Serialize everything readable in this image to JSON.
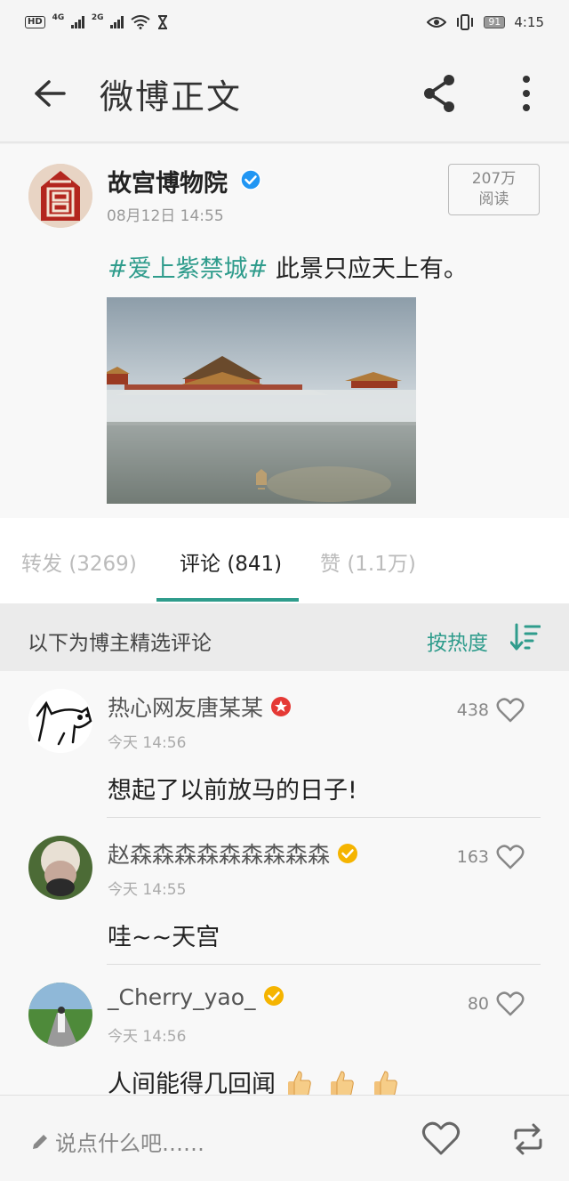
{
  "status_bar": {
    "hd": "HD",
    "net1": "4G",
    "net2": "2G",
    "battery": "91",
    "time": "4:15"
  },
  "header": {
    "title": "微博正文"
  },
  "post": {
    "author": "故宫博物院",
    "time": "08月12日 14:55",
    "reads_count": "207万",
    "reads_label": "阅读",
    "hashtag": "#爱上紫禁城#",
    "text": " 此景只应天上有。"
  },
  "tabs": [
    {
      "label": "转发",
      "count": "(3269)"
    },
    {
      "label": "评论",
      "count": "(841)"
    },
    {
      "label": "赞",
      "count": "(1.1万)"
    }
  ],
  "comments_header": {
    "label": "以下为博主精选评论",
    "sort": "按热度"
  },
  "comments": [
    {
      "name": "热心网友唐某某",
      "time": "今天 14:56",
      "text": "想起了以前放马的日子!",
      "likes": "438"
    },
    {
      "name": "赵森森森森森森森森森",
      "time": "今天 14:55",
      "text": "哇~~天宫",
      "likes": "163"
    },
    {
      "name": "_Cherry_yao_",
      "time": "今天 14:56",
      "text": "人间能得几回闻",
      "likes": "80"
    }
  ],
  "bottom_bar": {
    "placeholder": "说点什么吧……"
  },
  "colors": {
    "accent": "#2f9c8c",
    "verified_blue": "#2196f3",
    "verified_gold": "#f5b400",
    "verified_red": "#e53935"
  }
}
